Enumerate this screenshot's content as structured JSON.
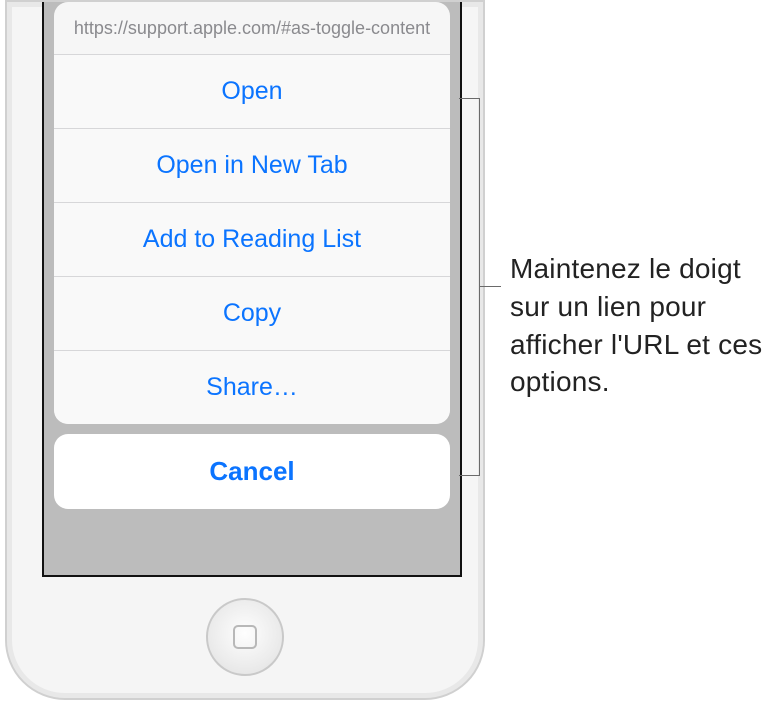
{
  "sheet": {
    "url": "https://support.apple.com/#as-toggle-content",
    "options": {
      "open": "Open",
      "open_new_tab": "Open in New Tab",
      "add_reading_list": "Add to Reading List",
      "copy": "Copy",
      "share": "Share…"
    },
    "cancel": "Cancel"
  },
  "callout": {
    "text": "Maintenez le doigt sur un lien pour afficher l'URL et ces options."
  }
}
